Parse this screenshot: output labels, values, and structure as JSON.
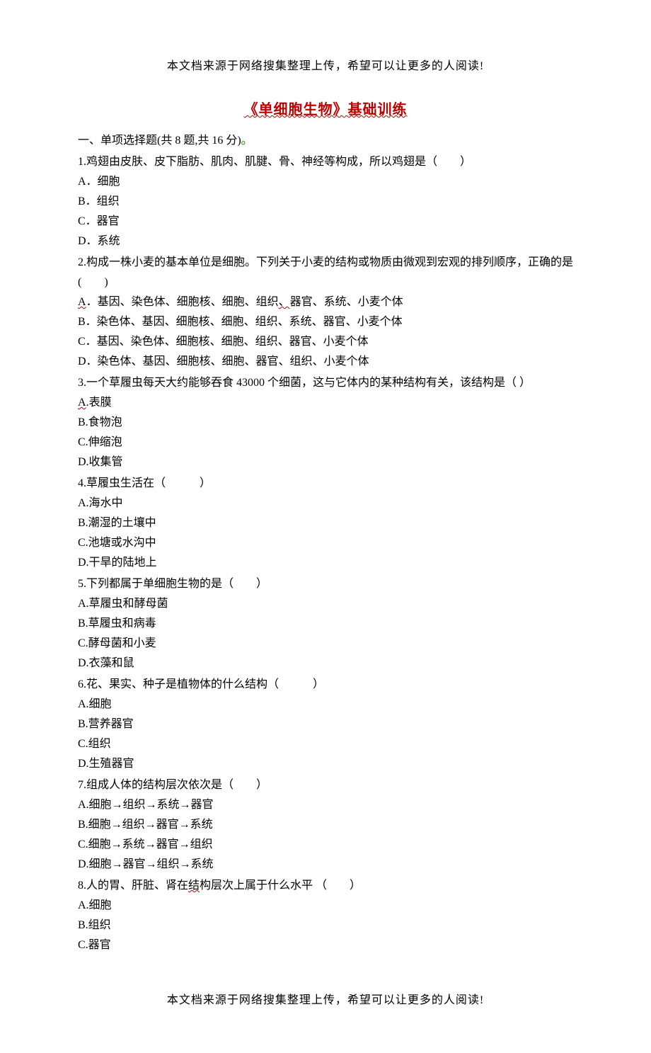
{
  "header_note": "本文档来源于网络搜集整理上传，希望可以让更多的人阅读!",
  "footer_note": "本文档来源于网络搜集整理上传，希望可以让更多的人阅读!",
  "title": "《单细胞生物》基础训练",
  "section_header_prefix": "一、单项选择题(共 8 题,共 16 分)",
  "section_header_dot": "。",
  "questions": [
    {
      "stem": "1.鸡翅由皮肤、皮下脂肪、肌肉、肌腱、骨、神经等构成，所以鸡翅是（　　）",
      "options": [
        "A．细胞",
        "B．组织",
        "C．器官",
        "D．系统"
      ]
    },
    {
      "stem": "2.构成一株小麦的基本单位是细胞。下列关于小麦的结构或物质由微观到宏观的排列顺序，正确的是(　　)",
      "wavy_option_a_prefix": "A",
      "wavy_option_a_rest": "．基因、染色体、细胞核、细胞、组织",
      "wavy_option_a_tail": "器官、系统、小麦个体",
      "options_rest": [
        "B．染色体、基因、细胞核、细胞、组织、系统、器官、小麦个体",
        "C．基因、染色体、细胞核、细胞、组织、器官、小麦个体",
        "D．染色体、基因、细胞核、细胞、器官、组织、小麦个体"
      ]
    },
    {
      "stem": "3.一个草履虫每天大约能够吞食 43000 个细菌，这与它体内的某种结构有关，该结构是（ ）",
      "wavy_a_prefix": "A",
      "wavy_a_rest": ".表膜",
      "options_rest": [
        "B.食物泡",
        "C.伸缩泡",
        "D.收集管"
      ]
    },
    {
      "stem": "4.草履虫生活在（　　　）",
      "options": [
        "A.海水中",
        "B.潮湿的土壤中",
        "C.池塘或水沟中",
        "D.干旱的陆地上"
      ]
    },
    {
      "stem": "5.下列都属于单细胞生物的是（　　）",
      "options": [
        "A.草履虫和酵母菌",
        "B.草履虫和病毒",
        "C.酵母菌和小麦",
        "D.衣藻和鼠"
      ]
    },
    {
      "stem": "6.花、果实、种子是植物体的什么结构（　　　）",
      "options": [
        "A.细胞",
        "B.营养器官",
        "C.组织",
        "D.生殖器官"
      ]
    },
    {
      "stem": "7.组成人体的结构层次依次是（　　）",
      "options": [
        "A.细胞→组织→系统→器官",
        "B.细胞→组织→器官→系统",
        "C.细胞→系统→器官→组织",
        "D.细胞→器官→组织→系统"
      ]
    },
    {
      "stem_prefix": "8.人的胃、肝脏、肾在",
      "stem_wavy": "结",
      "stem_suffix": "构层次上属于什么水平 （　　）",
      "options": [
        "A.细胞",
        "B.组织",
        "C.器官"
      ]
    }
  ]
}
